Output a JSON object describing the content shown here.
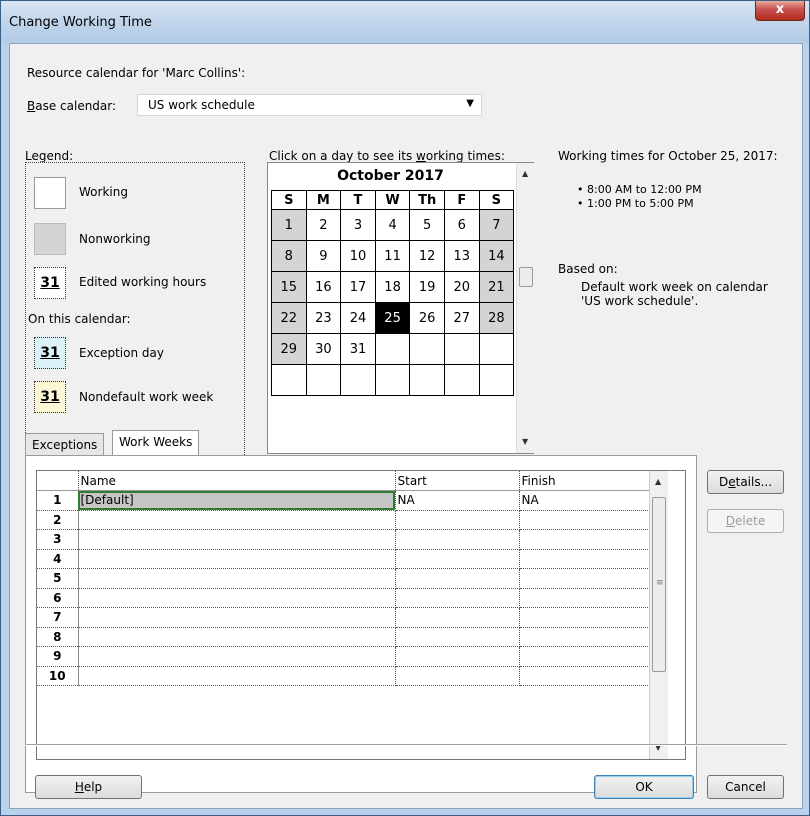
{
  "window": {
    "title": "Change Working Time",
    "close": "x"
  },
  "resource_label": "Resource calendar for 'Marc Collins':",
  "base_calendar": {
    "label_key": "B",
    "label_rest": "ase calendar:",
    "value": "US work schedule"
  },
  "legend": {
    "title": "Legend:",
    "working": "Working",
    "nonworking": "Nonworking",
    "edited": "Edited working hours",
    "on_this_calendar": "On this calendar:",
    "exception": "Exception day",
    "nondefault": "Nondefault work week",
    "num": "31"
  },
  "calendar": {
    "prompt_pre": "Click on a day to see its ",
    "prompt_key": "w",
    "prompt_post": "orking times:",
    "month": "October 2017",
    "weekdays": [
      "S",
      "M",
      "T",
      "W",
      "Th",
      "F",
      "S"
    ],
    "selected_day": 25,
    "rows": [
      [
        "1",
        "2",
        "3",
        "4",
        "5",
        "6",
        "7"
      ],
      [
        "8",
        "9",
        "10",
        "11",
        "12",
        "13",
        "14"
      ],
      [
        "15",
        "16",
        "17",
        "18",
        "19",
        "20",
        "21"
      ],
      [
        "22",
        "23",
        "24",
        "25",
        "26",
        "27",
        "28"
      ],
      [
        "29",
        "30",
        "31",
        "",
        "",
        "",
        ""
      ],
      [
        "",
        "",
        "",
        "",
        "",
        "",
        ""
      ]
    ]
  },
  "working_times": {
    "title": "Working times for October 25, 2017:",
    "slot1": "• 8:00 AM to 12:00 PM",
    "slot2": "• 1:00 PM to 5:00 PM",
    "based_on": "Based on:",
    "basis_line1": "Default work week on calendar",
    "basis_line2": "'US work schedule'."
  },
  "tabs": {
    "exceptions": "Exceptions",
    "work_weeks": "Work Weeks"
  },
  "grid": {
    "headers": {
      "name": "Name",
      "start": "Start",
      "finish": "Finish"
    },
    "row_numbers": [
      "1",
      "2",
      "3",
      "4",
      "5",
      "6",
      "7",
      "8",
      "9",
      "10"
    ],
    "row1": {
      "name": "[Default]",
      "start": "NA",
      "finish": "NA"
    }
  },
  "buttons": {
    "details_pre": "D",
    "details_key": "e",
    "details_post": "tails...",
    "delete_key": "D",
    "delete_post": "elete",
    "help_key": "H",
    "help_post": "elp",
    "ok": "OK",
    "cancel": "Cancel"
  }
}
